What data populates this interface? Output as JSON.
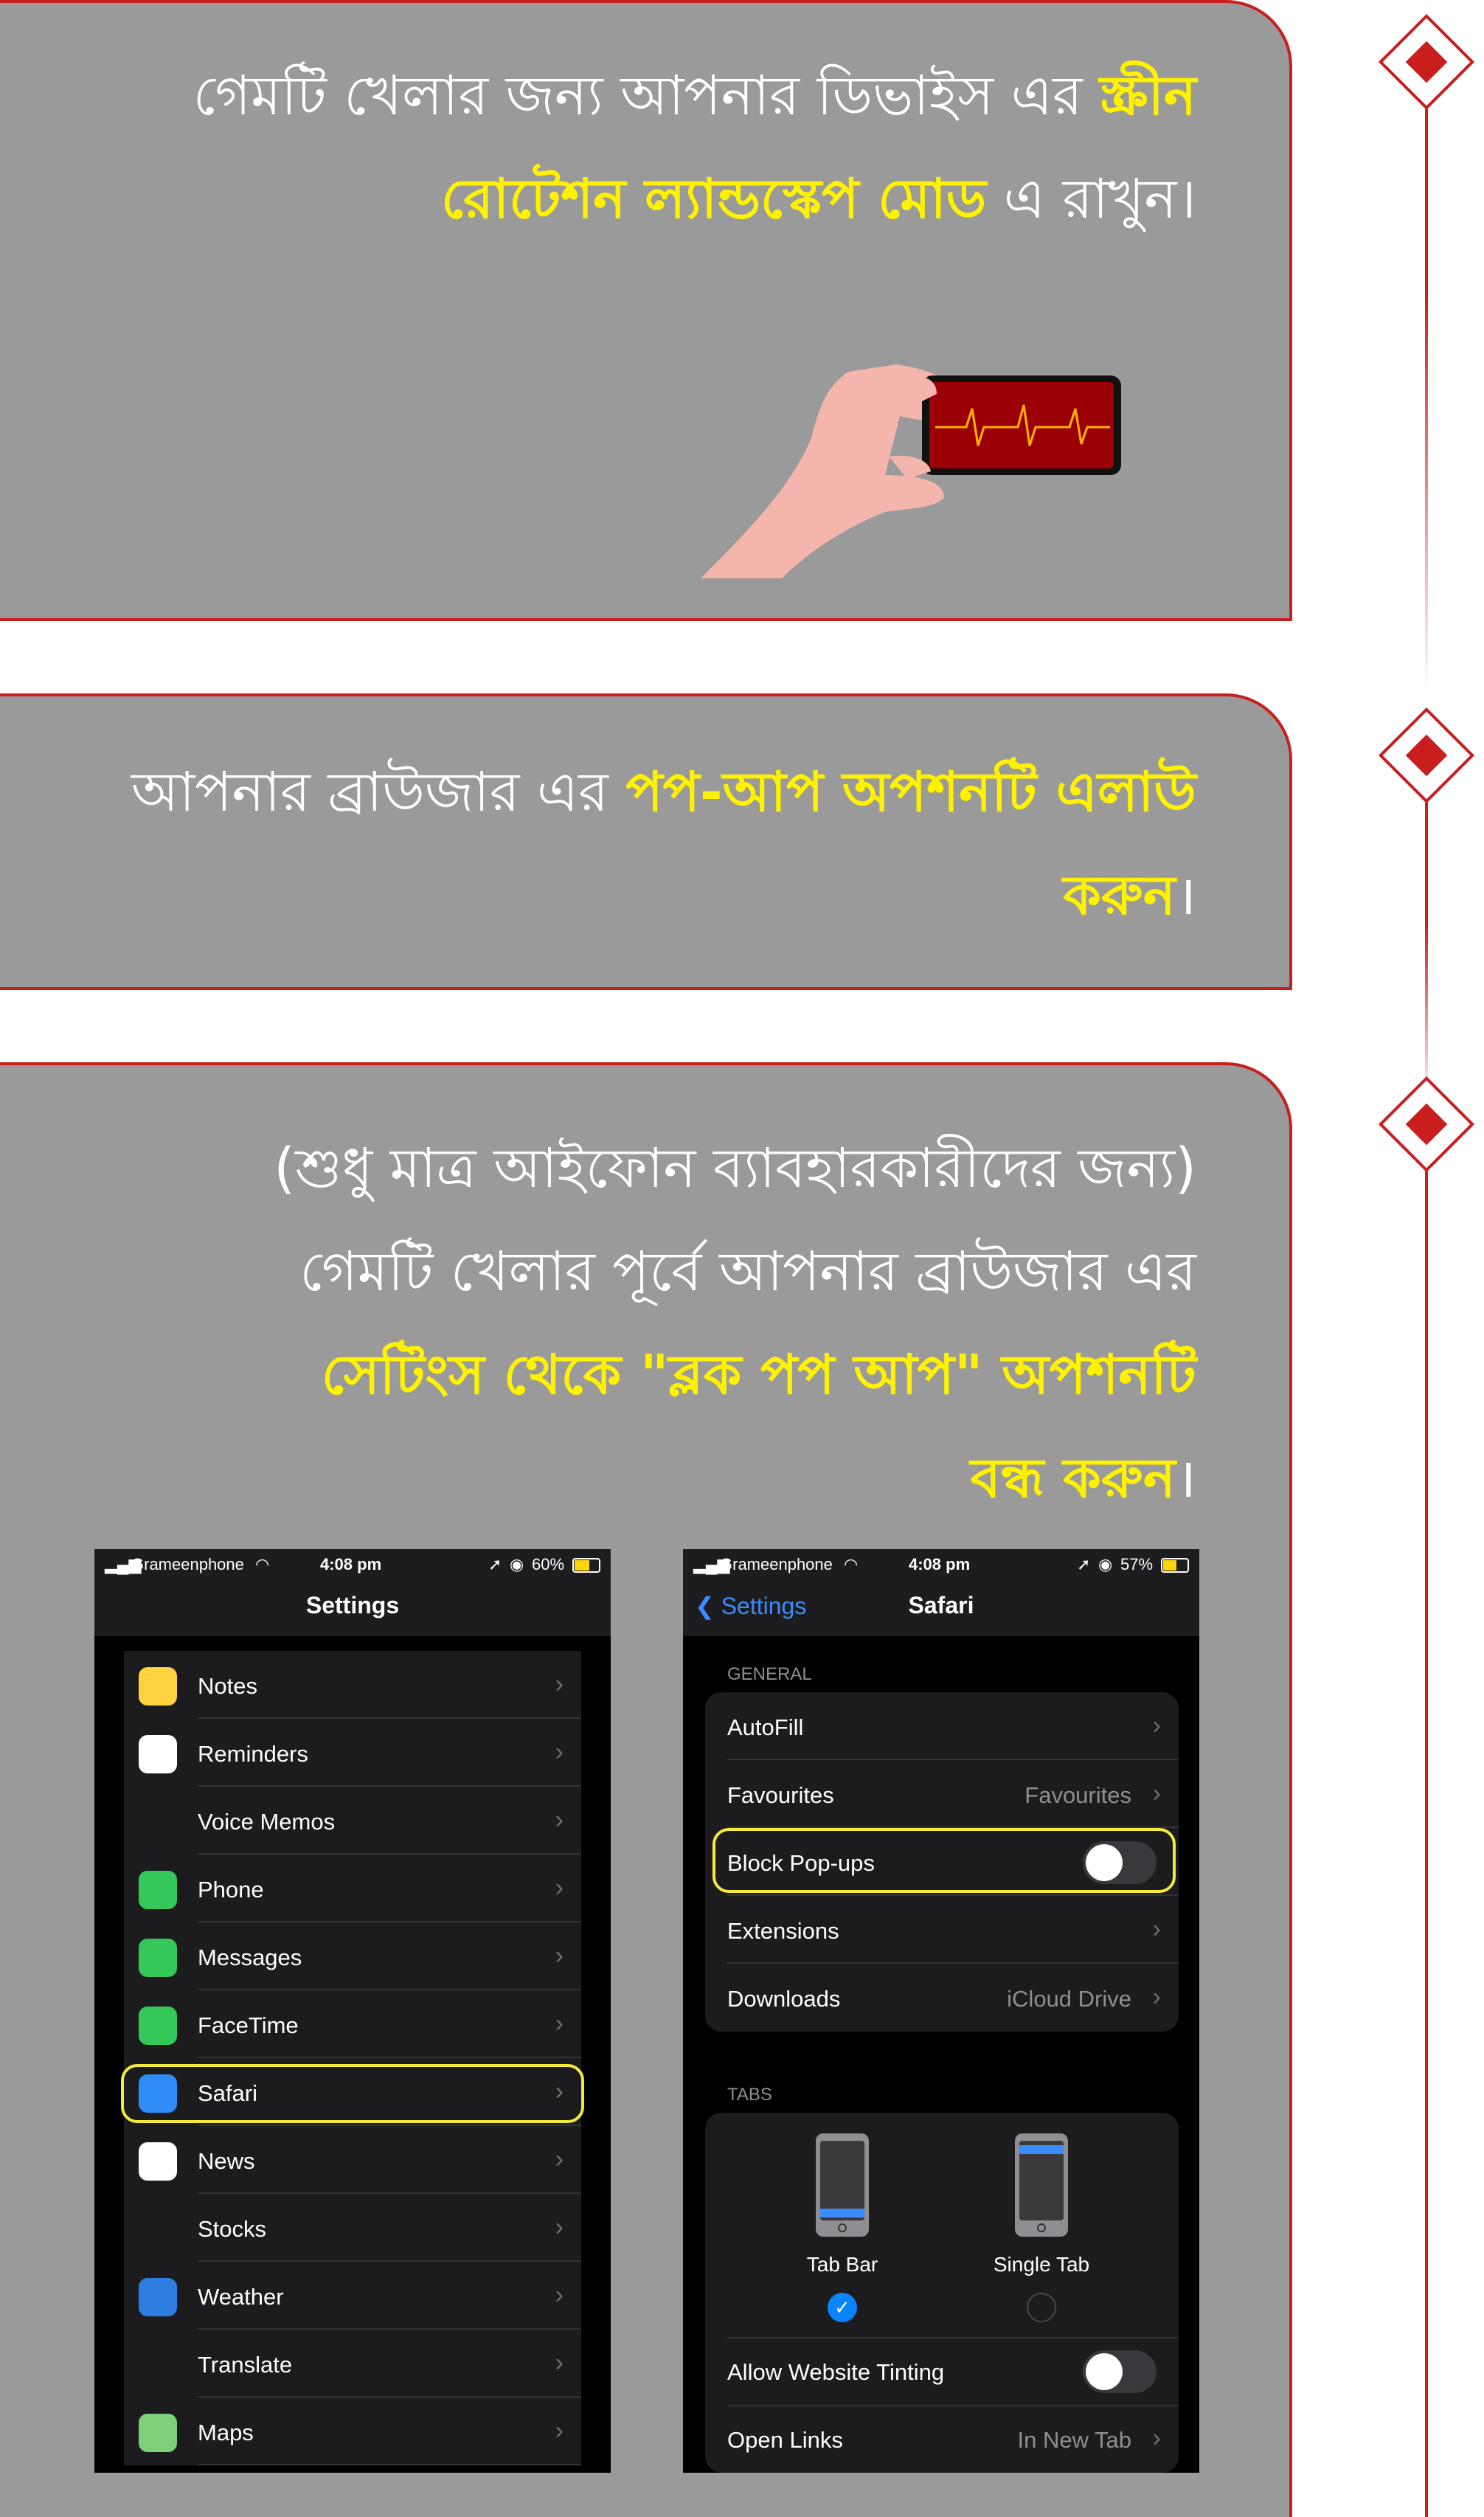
{
  "colors": {
    "card_bg": "#9a9a9a",
    "accent_red": "#c81e1e",
    "highlight_yellow": "#fff200",
    "ios_blue": "#3a8cff"
  },
  "step1": {
    "text_a": "গেমটি খেলার জন্য আপনার ডিভাইস এর ",
    "text_hl_1": "স্ক্রীন",
    "text_hl_2": "রোটেশন ল্যান্ডস্কেপ মোড",
    "text_b": " এ রাখুন।"
  },
  "step2": {
    "text_a": "আপনার ব্রাউজার এর ",
    "text_hl_1": "পপ-আপ অপশনটি এলাউ",
    "text_hl_2": "করুন",
    "text_b": "।"
  },
  "step3": {
    "line1": "(শুধু মাত্র আইফোন ব্যাবহারকারীদের জন্য)",
    "line2": "গেমটি খেলার পূর্বে আপনার ব্রাউজার এর",
    "text_hl_1": "সেটিংস থেকে \"ব্লক পপ আপ\" অপশনটি",
    "text_hl_2": "বন্ধ করুন",
    "text_b": "।"
  },
  "phone1": {
    "carrier": "Grameenphone",
    "time": "4:08 pm",
    "battery": "60%",
    "title": "Settings",
    "items": [
      {
        "label": "Notes",
        "icon": "notes-icon",
        "color": "#ffd23f"
      },
      {
        "label": "Reminders",
        "icon": "reminders-icon",
        "color": "#ffffff"
      },
      {
        "label": "Voice Memos",
        "icon": "voice-memos-icon",
        "color": "#1c1c1e"
      },
      {
        "label": "Phone",
        "icon": "phone-icon",
        "color": "#34c759"
      },
      {
        "label": "Messages",
        "icon": "messages-icon",
        "color": "#34c759"
      },
      {
        "label": "FaceTime",
        "icon": "facetime-icon",
        "color": "#34c759"
      },
      {
        "label": "Safari",
        "icon": "safari-icon",
        "color": "#2f8bf5"
      },
      {
        "label": "News",
        "icon": "news-icon",
        "color": "#ffffff"
      },
      {
        "label": "Stocks",
        "icon": "stocks-icon",
        "color": "#1c1c1e"
      },
      {
        "label": "Weather",
        "icon": "weather-icon",
        "color": "#2f7de1"
      },
      {
        "label": "Translate",
        "icon": "translate-icon",
        "color": "#1c1c1e"
      },
      {
        "label": "Maps",
        "icon": "maps-icon",
        "color": "#7ed07b"
      }
    ]
  },
  "phone2": {
    "carrier": "Grameenphone",
    "time": "4:08 pm",
    "battery": "57%",
    "back_label": "Settings",
    "title": "Safari",
    "general_header": "GENERAL",
    "general_items": [
      {
        "label": "AutoFill",
        "value": ""
      },
      {
        "label": "Favourites",
        "value": "Favourites"
      },
      {
        "label": "Block Pop-ups",
        "value": ""
      },
      {
        "label": "Extensions",
        "value": ""
      },
      {
        "label": "Downloads",
        "value": "iCloud Drive"
      }
    ],
    "tabs_header": "TABS",
    "tab_bar_label": "Tab Bar",
    "single_tab_label": "Single Tab",
    "tinting_label": "Allow Website Tinting",
    "open_links_label": "Open Links",
    "open_links_value": "In New Tab"
  }
}
